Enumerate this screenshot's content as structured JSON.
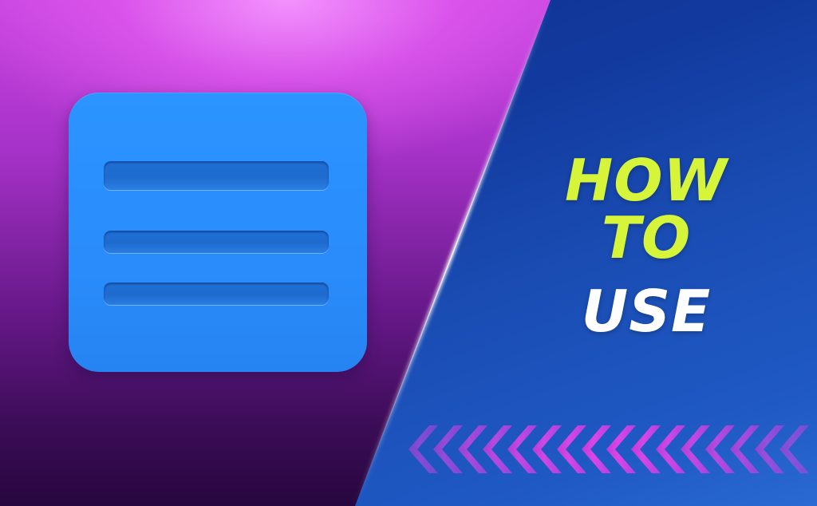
{
  "headline": {
    "line1": "HOW TO",
    "line2": "USE"
  },
  "icon": {
    "name": "list-lines-icon",
    "lines": 3
  },
  "decoration": {
    "chevrons": "left-pointing-chevrons"
  },
  "colors": {
    "accent_yellow": "#d6f53a",
    "text_white": "#ffffff",
    "icon_blue": "#2b94ff",
    "left_bg_top": "#e576f5",
    "left_bg_bottom": "#27073f",
    "right_bg": "#123a9e",
    "chevron_pink": "#e24ae8"
  }
}
